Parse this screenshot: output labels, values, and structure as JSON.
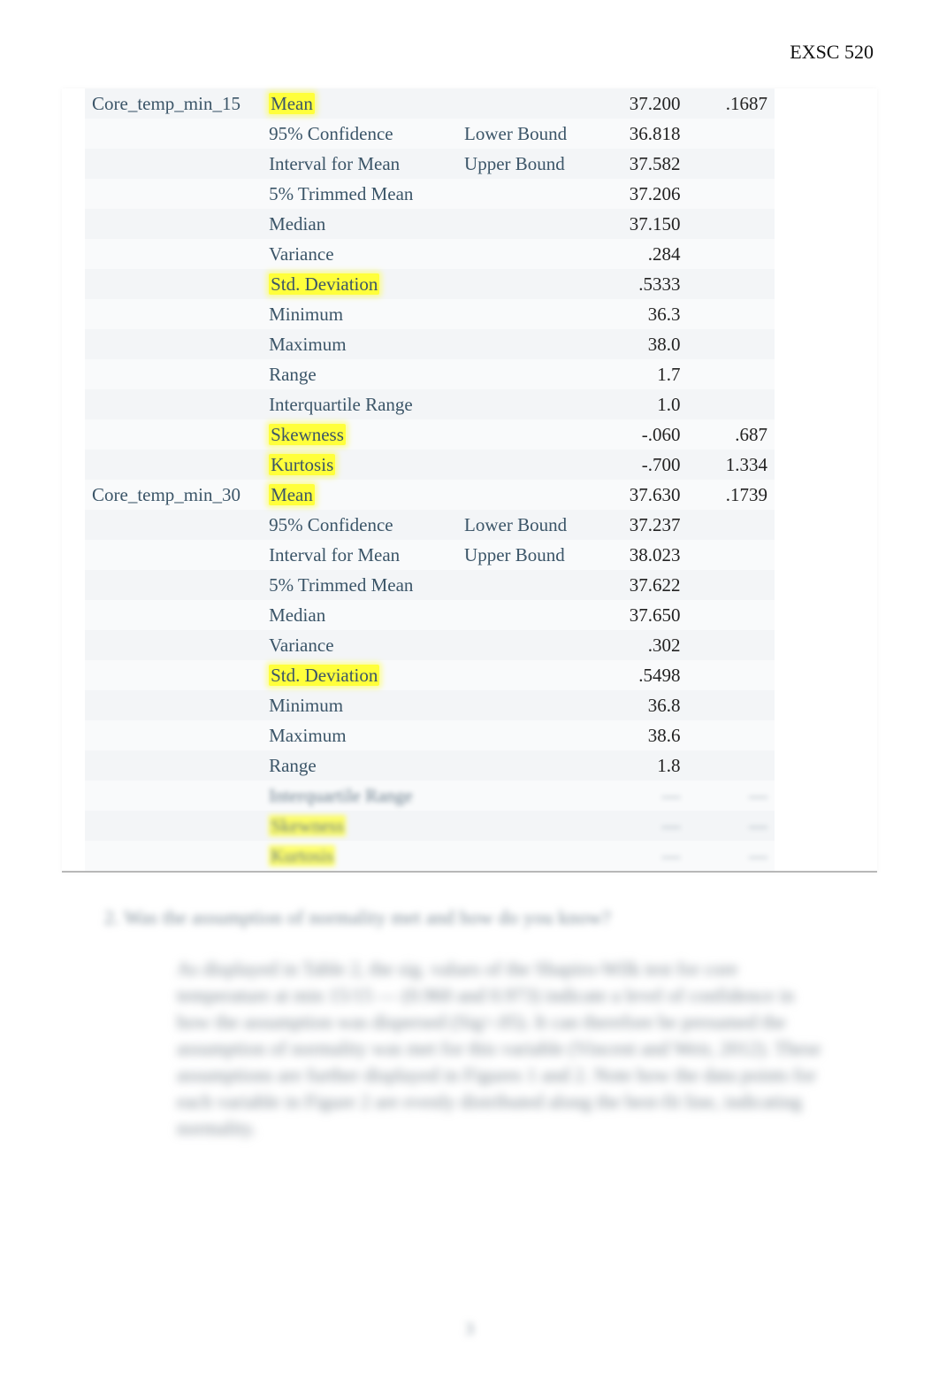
{
  "header": {
    "course_code": "EXSC 520"
  },
  "table": {
    "groups": [
      {
        "variable": "Core_temp_min_15",
        "rows": [
          {
            "label": "Mean",
            "sub": "",
            "value": "37.200",
            "se": ".1687",
            "hl": true
          },
          {
            "label": "95% Confidence",
            "sub": "Lower Bound",
            "value": "36.818",
            "se": ""
          },
          {
            "label": "Interval for Mean",
            "sub": "Upper Bound",
            "value": "37.582",
            "se": ""
          },
          {
            "label": "5% Trimmed Mean",
            "sub": "",
            "value": "37.206",
            "se": ""
          },
          {
            "label": "Median",
            "sub": "",
            "value": "37.150",
            "se": ""
          },
          {
            "label": "Variance",
            "sub": "",
            "value": ".284",
            "se": ""
          },
          {
            "label": "Std. Deviation",
            "sub": "",
            "value": ".5333",
            "se": "",
            "hl": true
          },
          {
            "label": "Minimum",
            "sub": "",
            "value": "36.3",
            "se": ""
          },
          {
            "label": "Maximum",
            "sub": "",
            "value": "38.0",
            "se": ""
          },
          {
            "label": "Range",
            "sub": "",
            "value": "1.7",
            "se": ""
          },
          {
            "label": "Interquartile Range",
            "sub": "",
            "value": "1.0",
            "se": ""
          },
          {
            "label": "Skewness",
            "sub": "",
            "value": "-.060",
            "se": ".687",
            "hl": true
          },
          {
            "label": "Kurtosis",
            "sub": "",
            "value": "-.700",
            "se": "1.334",
            "hl": true
          }
        ]
      },
      {
        "variable": "Core_temp_min_30",
        "rows": [
          {
            "label": "Mean",
            "sub": "",
            "value": "37.630",
            "se": ".1739",
            "hl": true
          },
          {
            "label": "95% Confidence",
            "sub": "Lower Bound",
            "value": "37.237",
            "se": ""
          },
          {
            "label": "Interval for Mean",
            "sub": "Upper Bound",
            "value": "38.023",
            "se": ""
          },
          {
            "label": "5% Trimmed Mean",
            "sub": "",
            "value": "37.622",
            "se": ""
          },
          {
            "label": "Median",
            "sub": "",
            "value": "37.650",
            "se": ""
          },
          {
            "label": "Variance",
            "sub": "",
            "value": ".302",
            "se": ""
          },
          {
            "label": "Std. Deviation",
            "sub": "",
            "value": ".5498",
            "se": "",
            "hl": true
          },
          {
            "label": "Minimum",
            "sub": "",
            "value": "36.8",
            "se": ""
          },
          {
            "label": "Maximum",
            "sub": "",
            "value": "38.6",
            "se": ""
          },
          {
            "label": "Range",
            "sub": "",
            "value": "1.8",
            "se": ""
          }
        ],
        "blurred_rows": [
          {
            "label": "Interquartile Range",
            "value": "",
            "se": ""
          },
          {
            "label": "Skewness",
            "value": "",
            "se": "",
            "hl": true
          },
          {
            "label": "Kurtosis",
            "value": "",
            "se": "",
            "hl": true
          }
        ]
      }
    ]
  },
  "question": "2.  Was the assumption of normality met and how do you know?",
  "answer_blur": "As displayed in Table 2, the sig. values of the Shapiro-Wilk test for core temperature at min 15/15 — (0.960 and 0.973) indicate a level of confidence in how the assumption was dispersed (Sig>.05). It can therefore be presumed the assumption of normality was met for this variable (Vincent and Weir, 2012). These assumptions are further displayed in Figures 1 and 2. Note how the data points for each variable in Figure 2 are evenly distributed along the best-fit line, indicating normality.",
  "page_number": "3"
}
